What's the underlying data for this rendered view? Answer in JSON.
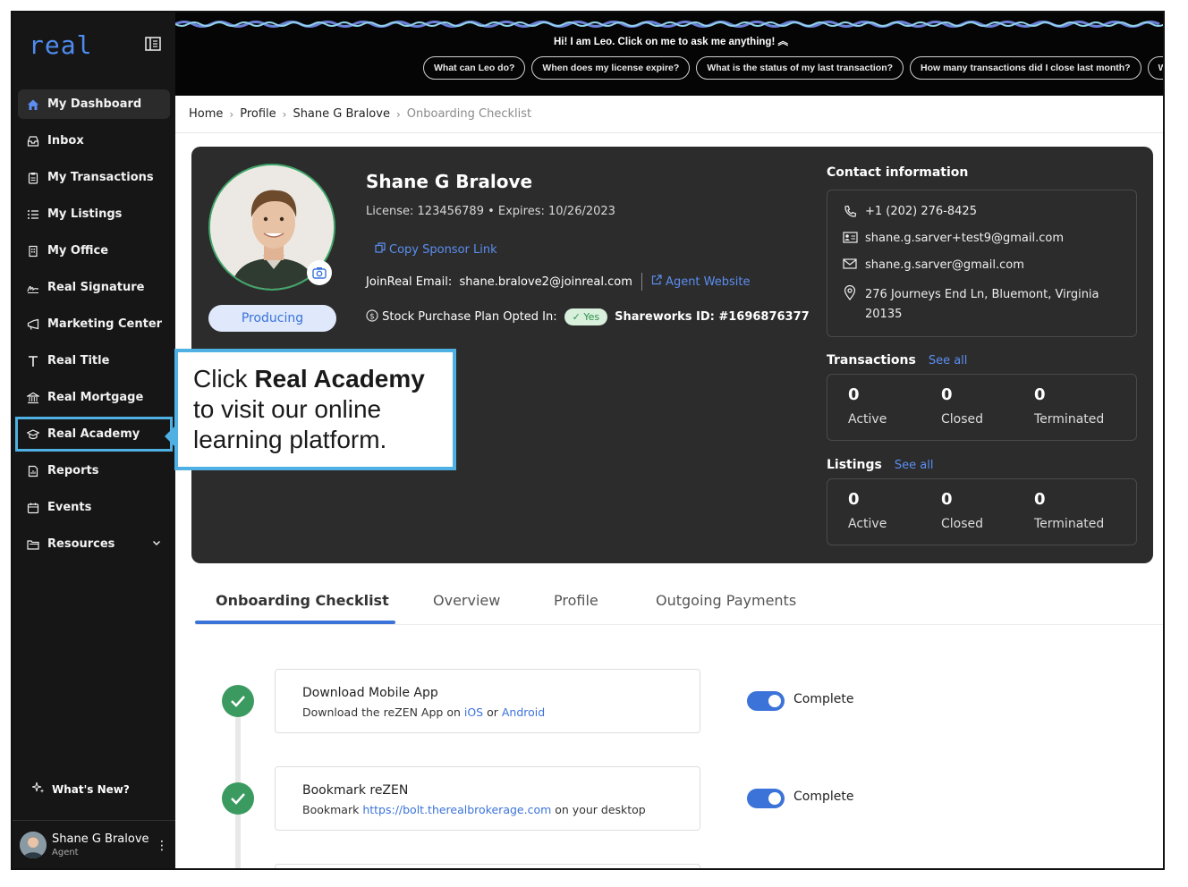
{
  "app": {
    "logo": "real"
  },
  "sidebar": {
    "items": [
      {
        "label": "My Dashboard",
        "icon": "home-icon"
      },
      {
        "label": "Inbox",
        "icon": "inbox-icon"
      },
      {
        "label": "My Transactions",
        "icon": "clipboard-icon"
      },
      {
        "label": "My Listings",
        "icon": "list-icon"
      },
      {
        "label": "My Office",
        "icon": "building-icon"
      },
      {
        "label": "Real Signature",
        "icon": "signature-icon"
      },
      {
        "label": "Marketing Center",
        "icon": "megaphone-icon"
      },
      {
        "label": "Real Title",
        "icon": "title-icon"
      },
      {
        "label": "Real Mortgage",
        "icon": "bank-icon"
      },
      {
        "label": "Real Academy",
        "icon": "graduation-cap-icon"
      },
      {
        "label": "Reports",
        "icon": "report-icon"
      },
      {
        "label": "Events",
        "icon": "calendar-icon"
      },
      {
        "label": "Resources",
        "icon": "folder-icon"
      }
    ],
    "whats_new": "What's New?",
    "user": {
      "name": "Shane G Bralove",
      "role": "Agent"
    }
  },
  "topbar": {
    "leo_message": "Hi! I am Leo. Click on me to ask me anything!",
    "chips": [
      "What can Leo do?",
      "When does my license expire?",
      "What is the status of my last transaction?",
      "How many transactions did I close last month?",
      "What w"
    ]
  },
  "breadcrumb": [
    "Home",
    "Profile",
    "Shane G Bralove",
    "Onboarding Checklist"
  ],
  "profile": {
    "name": "Shane G Bralove",
    "license_line": "License: 123456789  •  Expires: 10/26/2023",
    "status_badge": "Producing",
    "copy_sponsor": "Copy Sponsor Link",
    "email_label": "JoinReal Email:",
    "email_value": "shane.bralove2@joinreal.com",
    "agent_website": "Agent Website",
    "stock_label": "Stock Purchase Plan Opted In:",
    "stock_value": "Yes",
    "shareworks": "Shareworks ID:  #1696876377"
  },
  "contact": {
    "title": "Contact information",
    "phone": "+1 (202) 276-8425",
    "email_alt": "shane.g.sarver+test9@gmail.com",
    "email": "shane.g.sarver@gmail.com",
    "address_line1": "276 Journeys End Ln, Bluemont, Virginia",
    "address_line2": "20135"
  },
  "transactions": {
    "title": "Transactions",
    "see_all": "See all",
    "stats": [
      {
        "value": "0",
        "label": "Active"
      },
      {
        "value": "0",
        "label": "Closed"
      },
      {
        "value": "0",
        "label": "Terminated"
      }
    ]
  },
  "listings": {
    "title": "Listings",
    "see_all": "See all",
    "stats": [
      {
        "value": "0",
        "label": "Active"
      },
      {
        "value": "0",
        "label": "Closed"
      },
      {
        "value": "0",
        "label": "Terminated"
      }
    ]
  },
  "tabs": [
    "Onboarding Checklist",
    "Overview",
    "Profile",
    "Outgoing Payments"
  ],
  "checklist": [
    {
      "title": "Download Mobile App",
      "desc_pre": "Download the reZEN App on ",
      "link1": "iOS",
      "desc_mid": " or ",
      "link2": "Android",
      "status": "Complete"
    },
    {
      "title": "Bookmark reZEN",
      "desc_pre": "Bookmark ",
      "link1": "https://bolt.therealbrokerage.com",
      "desc_mid": " on your desktop",
      "status": "Complete"
    }
  ],
  "callout": {
    "pre": "Click ",
    "bold": "Real Academy",
    "rest": "to visit our online learning platform."
  },
  "colors": {
    "accent": "#3b73d9",
    "success": "#3b9a5f",
    "callout_border": "#4fb1e3",
    "card_bg": "#2c2c2c"
  }
}
